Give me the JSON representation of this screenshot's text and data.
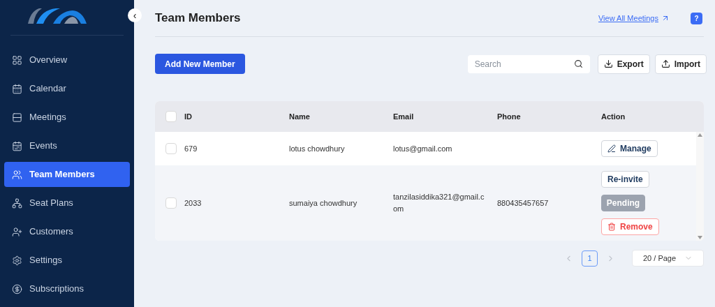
{
  "sidebar": {
    "collapse_glyph": "‹",
    "items": [
      {
        "label": "Overview",
        "selected": false
      },
      {
        "label": "Calendar",
        "selected": false
      },
      {
        "label": "Meetings",
        "selected": false
      },
      {
        "label": "Events",
        "selected": false
      },
      {
        "label": "Team Members",
        "selected": true
      },
      {
        "label": "Seat Plans",
        "selected": false
      },
      {
        "label": "Customers",
        "selected": false
      },
      {
        "label": "Settings",
        "selected": false
      },
      {
        "label": "Subscriptions",
        "selected": false
      }
    ]
  },
  "header": {
    "title": "Team Members",
    "link": "View All Meetings",
    "help": "?"
  },
  "toolbar": {
    "add_button": "Add New Member",
    "search": {
      "placeholder": "Search"
    },
    "buttons": [
      {
        "label": "Export",
        "kind": "download"
      },
      {
        "label": "Import",
        "kind": "upload"
      }
    ]
  },
  "table": {
    "columns": [
      "ID",
      "Name",
      "Email",
      "Phone",
      "Action"
    ],
    "header_checked": false,
    "rows": [
      {
        "checked": false,
        "id": "679",
        "name": "lotus chowdhury",
        "email": "lotus@gmail.com",
        "actions": [
          {
            "label": "Manage",
            "kind": "edit",
            "disabled": false
          }
        ]
      },
      {
        "checked": false,
        "id": "2033",
        "name": "sumaiya chowdhury",
        "email": "tanzilasiddika321@gmail.com",
        "phone": "880435457657",
        "actions": [
          {
            "label": "Re-invite",
            "kind": "plain",
            "disabled": false
          },
          {
            "label": "Pending",
            "kind": "plain",
            "disabled": true
          },
          {
            "label": "Remove",
            "kind": "delete",
            "disabled": false
          }
        ]
      }
    ]
  },
  "pagination": {
    "pages": [
      {
        "label": "1",
        "selected": true
      }
    ],
    "page_size": "20 / Page"
  }
}
